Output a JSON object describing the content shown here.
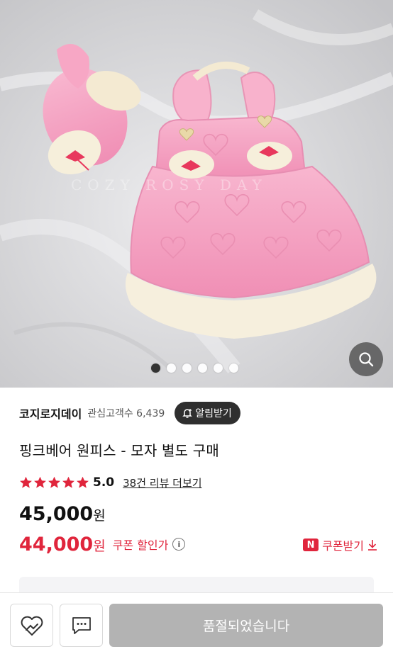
{
  "image_carousel": {
    "watermark": "COZY ROSY DAY",
    "dot_count": 6,
    "active_index": 0
  },
  "store": {
    "name": "코지로지데이",
    "followers_label": "관심고객수 6,439",
    "follow_button_label": "알림받기"
  },
  "product": {
    "title": "핑크베어 원피스 - 모자 별도 구매",
    "rating": "5.0",
    "stars": 5,
    "review_link": "38건 리뷰 더보기",
    "original_price": "45,000",
    "sale_price": "44,000",
    "price_unit": "원",
    "coupon_price_label": "쿠폰 할인가",
    "coupon_download_label": "쿠폰받기",
    "coupon_badge": "N"
  },
  "bottom_bar": {
    "soldout_label": "품절되었습니다"
  },
  "colors": {
    "accent_red": "#e0253c",
    "star_red": "#e0253c",
    "dark_button": "#2f2f2f",
    "soldout_grey": "#b3b3b3",
    "product_pink": "#f4a9c4"
  }
}
